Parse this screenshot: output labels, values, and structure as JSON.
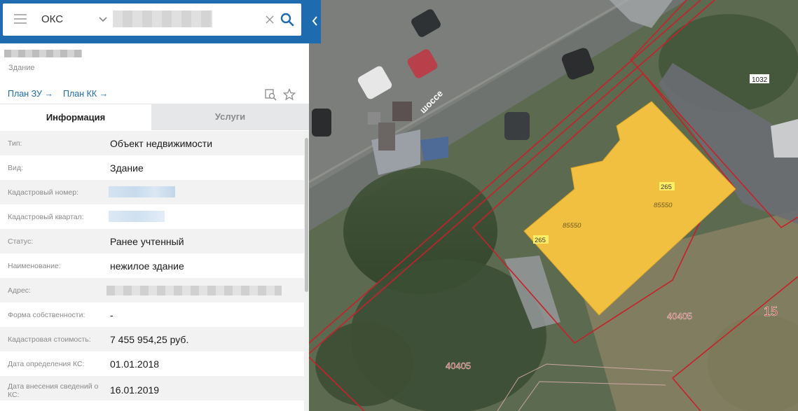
{
  "search": {
    "type_value": "ОКС",
    "value": ""
  },
  "object": {
    "kind": "Здание"
  },
  "links": {
    "plan_zu": "План ЗУ →",
    "plan_kk": "План КК →"
  },
  "tabs": [
    {
      "label": "Информация",
      "active": true
    },
    {
      "label": "Услуги",
      "active": false
    }
  ],
  "info": {
    "rows": [
      {
        "label": "Тип:",
        "value": "Объект недвижимости"
      },
      {
        "label": "Вид:",
        "value": "Здание"
      },
      {
        "label": "Кадастровый номер:",
        "value": ""
      },
      {
        "label": "Кадастровый квартал:",
        "value": ""
      },
      {
        "label": "Статус:",
        "value": "Ранее учтенный"
      },
      {
        "label": "Наименование:",
        "value": "нежилое здание"
      },
      {
        "label": "Адрес:",
        "value": ""
      },
      {
        "label": "Форма собственности:",
        "value": "-"
      },
      {
        "label": "Кадастровая стоимость:",
        "value": "7 455 954,25 руб."
      },
      {
        "label": "Дата определения КС:",
        "value": "01.01.2018"
      },
      {
        "label": "Дата внесения сведений о КС:",
        "value": "16.01.2019"
      }
    ]
  },
  "map": {
    "street_label": "шоссе",
    "labels": {
      "num_1032": "1032",
      "num_265_a": "265",
      "num_265_b": "265",
      "num_85550_a": "85550",
      "num_85550_b": "85550",
      "num_40405_a": "40405",
      "num_40405_b": "40405",
      "num_15": "15"
    },
    "colors": {
      "building_fill": "#f2c040",
      "parcel_line": "#c8202a",
      "label_red": "#b01818"
    }
  },
  "colors": {
    "accent": "#1e6bb0"
  }
}
